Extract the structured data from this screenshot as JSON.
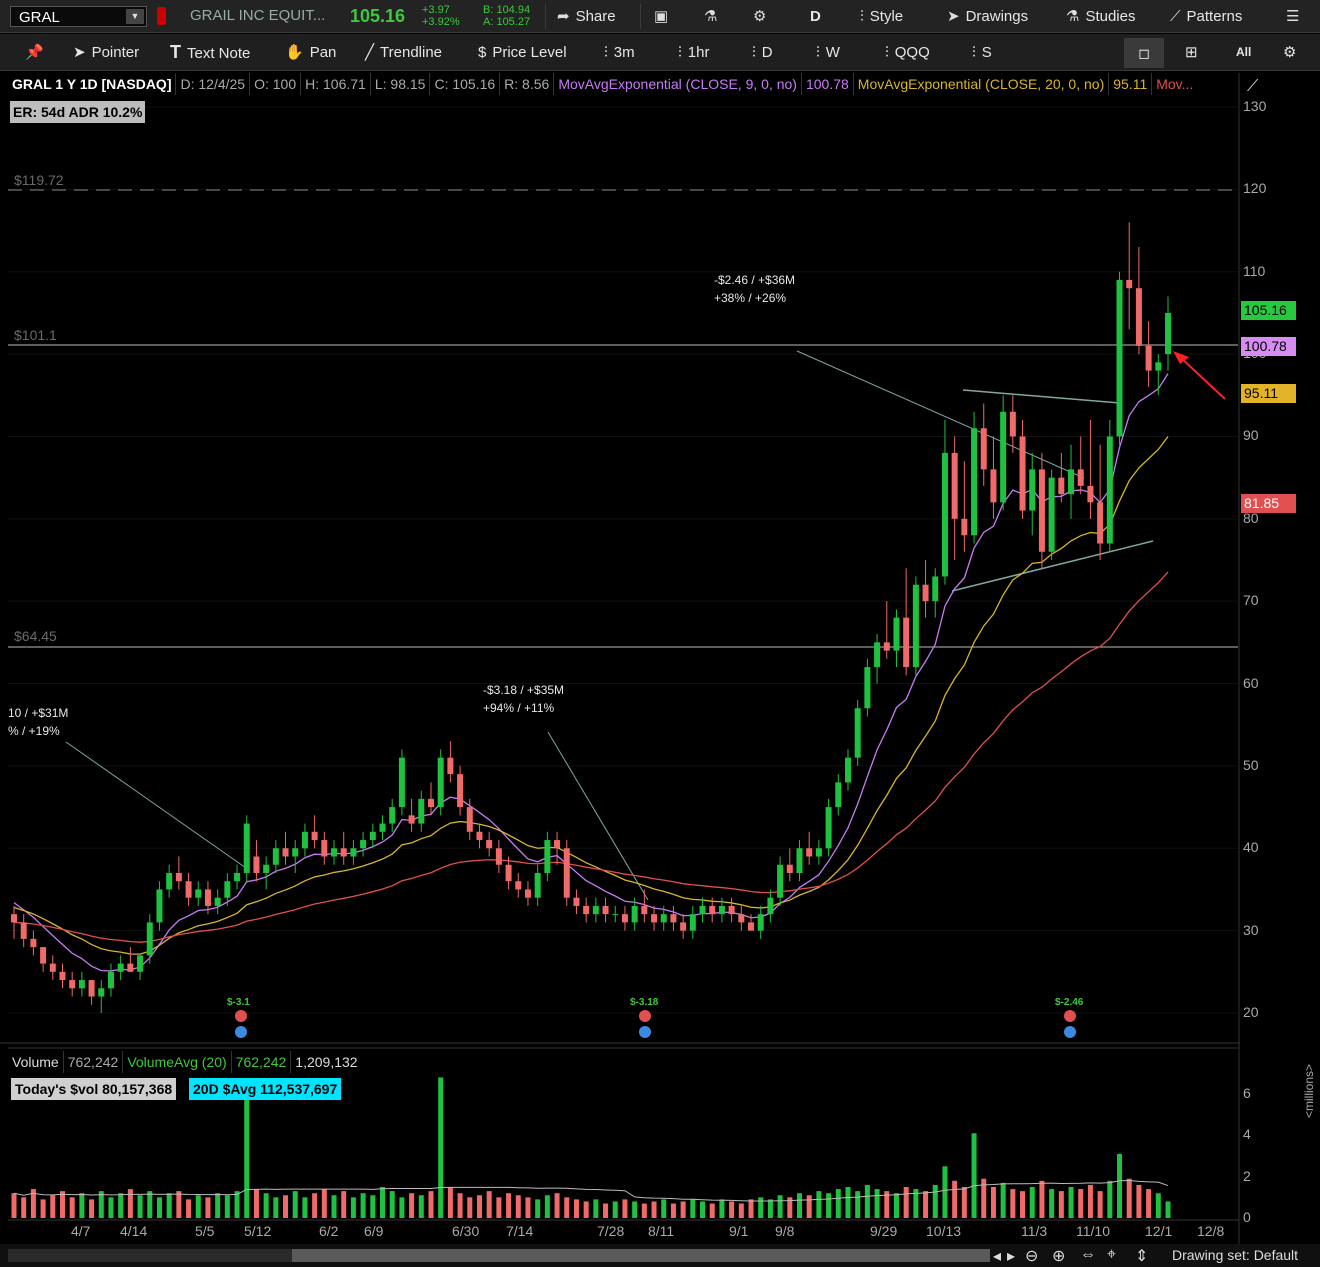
{
  "header": {
    "symbol": "GRAL",
    "company": "GRAIL INC EQUIT...",
    "last": "105.16",
    "change": "+3.97",
    "change_pct": "+3.92%",
    "bid": "B: 104.94",
    "ask": "A: 105.27",
    "buttons": {
      "share": "Share",
      "aggregation": "D",
      "style": "Style",
      "drawings": "Drawings",
      "studies": "Studies",
      "patterns": "Patterns"
    }
  },
  "toolbar": {
    "pointer": "Pointer",
    "text_note": "Text Note",
    "pan": "Pan",
    "trendline": "Trendline",
    "price_level": "Price Level",
    "tf_3m": "3m",
    "tf_1hr": "1hr",
    "tf_d": "D",
    "tf_w": "W",
    "tf_qqq": "QQQ",
    "tf_s": "S",
    "all": "All"
  },
  "chart_info": {
    "title": "GRAL 1 Y 1D [NASDAQ]",
    "date": "D: 12/4/25",
    "open": "O: 100",
    "high": "H: 106.71",
    "low": "L: 98.15",
    "close": "C: 105.16",
    "range": "R: 8.56",
    "ema9_label": "MovAvgExponential (CLOSE, 9, 0, no)",
    "ema9_value": "100.78",
    "ema20_label": "MovAvgExponential (CLOSE, 20, 0, no)",
    "ema20_value": "95.11",
    "ema_more": "Mov...",
    "er": "ER: 54d",
    "adr": "ADR 10.2%"
  },
  "levels": {
    "l1": "$119.72",
    "l2": "$101.1",
    "l3": "$64.45"
  },
  "notes": {
    "n1a": "-$2.46 / +$36M",
    "n1b": "+38% / +26%",
    "n2a": "-$3.18 / +$35M",
    "n2b": "+94% / +11%",
    "n3a": "10 / +$31M",
    "n3b": "% / +19%"
  },
  "earnings": {
    "e1": "$-3.1",
    "e2": "$-3.18",
    "e3": "$-2.46"
  },
  "price_badges": {
    "last": "105.16",
    "ema9": "100.78",
    "ema20": "95.11",
    "ema50": "81.85"
  },
  "volume": {
    "label": "Volume",
    "value": "762,242",
    "avg_label": "VolumeAvg (20)",
    "avg_value": "762,242",
    "avg_value2": "1,209,132",
    "todays": "Today's $vol 80,157,368",
    "avg20": "20D $Avg 112,537,697",
    "unit": "<millions>"
  },
  "x_labels": [
    "4/7",
    "4/14",
    "5/5",
    "5/12",
    "6/2",
    "6/9",
    "6/30",
    "7/14",
    "7/28",
    "8/11",
    "9/1",
    "9/8",
    "9/29",
    "10/13",
    "11/3",
    "11/10",
    "12/1",
    "12/8"
  ],
  "footer": {
    "drawing_set": "Drawing set: Default"
  },
  "chart_data": {
    "type": "candlestick",
    "ylim": [
      17,
      134
    ],
    "yticks": [
      20,
      30,
      40,
      50,
      60,
      70,
      80,
      90,
      100,
      110,
      120,
      130
    ],
    "volume_ylim": [
      0,
      7
    ],
    "volume_yticks": [
      0,
      2,
      4,
      6
    ],
    "x_labels": [
      "4/7",
      "4/14",
      "5/5",
      "5/12",
      "6/2",
      "6/9",
      "6/30",
      "7/14",
      "7/28",
      "8/11",
      "9/1",
      "9/8",
      "9/29",
      "10/13",
      "11/3",
      "11/10",
      "12/1",
      "12/8"
    ],
    "candles": [
      [
        32,
        33,
        29,
        31
      ],
      [
        31,
        32,
        28,
        29
      ],
      [
        29,
        30,
        27,
        28
      ],
      [
        28,
        28,
        25,
        26
      ],
      [
        26,
        27,
        24,
        25
      ],
      [
        25,
        26,
        23,
        24
      ],
      [
        24,
        25,
        22,
        23
      ],
      [
        23,
        25,
        22,
        24
      ],
      [
        24,
        24,
        21,
        22
      ],
      [
        22,
        24,
        20,
        23
      ],
      [
        23,
        26,
        22,
        25
      ],
      [
        25,
        27,
        24,
        26
      ],
      [
        26,
        28,
        25,
        25
      ],
      [
        25,
        27,
        24,
        27
      ],
      [
        27,
        32,
        26,
        31
      ],
      [
        31,
        36,
        30,
        35
      ],
      [
        35,
        38,
        34,
        37
      ],
      [
        37,
        39,
        35,
        36
      ],
      [
        36,
        37,
        33,
        34
      ],
      [
        34,
        36,
        33,
        35
      ],
      [
        35,
        36,
        32,
        33
      ],
      [
        33,
        35,
        32,
        34
      ],
      [
        34,
        37,
        33,
        36
      ],
      [
        36,
        38,
        35,
        37
      ],
      [
        37,
        44,
        36,
        43
      ],
      [
        39,
        41,
        36,
        37
      ],
      [
        37,
        39,
        35,
        38
      ],
      [
        38,
        41,
        37,
        40
      ],
      [
        40,
        42,
        38,
        39
      ],
      [
        39,
        41,
        37,
        40
      ],
      [
        40,
        43,
        39,
        42
      ],
      [
        42,
        44,
        40,
        41
      ],
      [
        41,
        42,
        38,
        39
      ],
      [
        39,
        41,
        38,
        40
      ],
      [
        40,
        42,
        38,
        39
      ],
      [
        39,
        41,
        38,
        40
      ],
      [
        40,
        42,
        39,
        41
      ],
      [
        41,
        43,
        40,
        42
      ],
      [
        42,
        44,
        41,
        43
      ],
      [
        43,
        46,
        42,
        45
      ],
      [
        45,
        52,
        44,
        51
      ],
      [
        44,
        46,
        42,
        43
      ],
      [
        43,
        47,
        42,
        46
      ],
      [
        46,
        48,
        44,
        45
      ],
      [
        45,
        52,
        44,
        51
      ],
      [
        51,
        53,
        48,
        49
      ],
      [
        49,
        50,
        44,
        45
      ],
      [
        45,
        46,
        41,
        42
      ],
      [
        42,
        43,
        40,
        41
      ],
      [
        41,
        42,
        39,
        40
      ],
      [
        40,
        41,
        37,
        38
      ],
      [
        38,
        39,
        35,
        36
      ],
      [
        36,
        37,
        34,
        35
      ],
      [
        35,
        36,
        33,
        34
      ],
      [
        34,
        38,
        33,
        37
      ],
      [
        37,
        42,
        36,
        41
      ],
      [
        41,
        42,
        38,
        40
      ],
      [
        40,
        41,
        33,
        34
      ],
      [
        34,
        35,
        32,
        33
      ],
      [
        33,
        34,
        31,
        32
      ],
      [
        32,
        34,
        31,
        33
      ],
      [
        33,
        34,
        31,
        32
      ],
      [
        32,
        33,
        31,
        32
      ],
      [
        32,
        33,
        30,
        31
      ],
      [
        31,
        34,
        30,
        33
      ],
      [
        33,
        35,
        31,
        32
      ],
      [
        32,
        33,
        30,
        31
      ],
      [
        31,
        33,
        30,
        32
      ],
      [
        32,
        33,
        30,
        31
      ],
      [
        31,
        32,
        29,
        30
      ],
      [
        30,
        33,
        29,
        32
      ],
      [
        32,
        34,
        31,
        33
      ],
      [
        33,
        34,
        31,
        32
      ],
      [
        32,
        34,
        31,
        33
      ],
      [
        33,
        34,
        31,
        32
      ],
      [
        32,
        33,
        30,
        31
      ],
      [
        31,
        32,
        30,
        30
      ],
      [
        30,
        33,
        29,
        32
      ],
      [
        32,
        35,
        31,
        34
      ],
      [
        34,
        39,
        33,
        38
      ],
      [
        38,
        40,
        36,
        37
      ],
      [
        37,
        41,
        36,
        40
      ],
      [
        40,
        42,
        38,
        39
      ],
      [
        39,
        41,
        38,
        40
      ],
      [
        40,
        46,
        39,
        45
      ],
      [
        45,
        49,
        44,
        48
      ],
      [
        48,
        52,
        47,
        51
      ],
      [
        51,
        58,
        50,
        57
      ],
      [
        57,
        63,
        56,
        62
      ],
      [
        62,
        66,
        60,
        65
      ],
      [
        65,
        70,
        63,
        64
      ],
      [
        64,
        69,
        62,
        68
      ],
      [
        68,
        74,
        61,
        62
      ],
      [
        62,
        73,
        61,
        72
      ],
      [
        72,
        75,
        68,
        70
      ],
      [
        70,
        74,
        68,
        73
      ],
      [
        73,
        92,
        72,
        88
      ],
      [
        88,
        90,
        75,
        80
      ],
      [
        80,
        87,
        76,
        78
      ],
      [
        78,
        93,
        77,
        91
      ],
      [
        91,
        94,
        84,
        86
      ],
      [
        86,
        90,
        80,
        82
      ],
      [
        82,
        95,
        81,
        93
      ],
      [
        93,
        95,
        88,
        90
      ],
      [
        90,
        92,
        80,
        81
      ],
      [
        81,
        88,
        78,
        86
      ],
      [
        86,
        88,
        74,
        76
      ],
      [
        76,
        86,
        75,
        85
      ],
      [
        85,
        88,
        82,
        83
      ],
      [
        83,
        89,
        80,
        86
      ],
      [
        86,
        90,
        83,
        84
      ],
      [
        84,
        92,
        80,
        82
      ],
      [
        82,
        89,
        75,
        77
      ],
      [
        77,
        92,
        76,
        90
      ],
      [
        90,
        110,
        89,
        109
      ],
      [
        109,
        116,
        103,
        108
      ],
      [
        108,
        113,
        100,
        101
      ],
      [
        101,
        104,
        96,
        98
      ],
      [
        98,
        100,
        95,
        99
      ],
      [
        100,
        107,
        98,
        105
      ]
    ],
    "volumes": [
      1.2,
      1.0,
      1.4,
      0.9,
      1.1,
      1.3,
      1.0,
      1.2,
      0.9,
      1.3,
      1.0,
      1.2,
      1.4,
      1.1,
      1.3,
      1.0,
      1.2,
      1.3,
      0.9,
      1.1,
      1.0,
      1.2,
      1.1,
      1.3,
      5.8,
      1.4,
      1.2,
      1.0,
      1.1,
      1.3,
      1.0,
      1.2,
      1.4,
      1.1,
      1.3,
      1.0,
      1.2,
      1.1,
      1.5,
      1.3,
      1.0,
      1.2,
      1.1,
      1.3,
      6.8,
      1.5,
      1.2,
      1.0,
      1.1,
      1.3,
      1.0,
      1.2,
      1.1,
      1.0,
      0.9,
      1.1,
      1.2,
      1.0,
      0.9,
      0.8,
      0.9,
      0.7,
      0.8,
      0.9,
      0.8,
      0.7,
      0.8,
      0.9,
      0.7,
      0.8,
      0.9,
      0.8,
      0.7,
      0.9,
      0.8,
      0.7,
      0.9,
      1.0,
      0.9,
      1.1,
      1.0,
      1.2,
      1.1,
      1.3,
      1.2,
      1.4,
      1.5,
      1.3,
      1.6,
      1.4,
      1.3,
      1.2,
      1.5,
      1.4,
      1.3,
      1.6,
      2.5,
      1.8,
      1.5,
      4.1,
      1.9,
      1.5,
      1.7,
      1.4,
      1.3,
      1.5,
      1.8,
      1.4,
      1.3,
      1.5,
      1.4,
      1.6,
      1.3,
      1.8,
      3.1,
      1.9,
      1.6,
      1.4,
      1.2,
      0.8
    ]
  }
}
